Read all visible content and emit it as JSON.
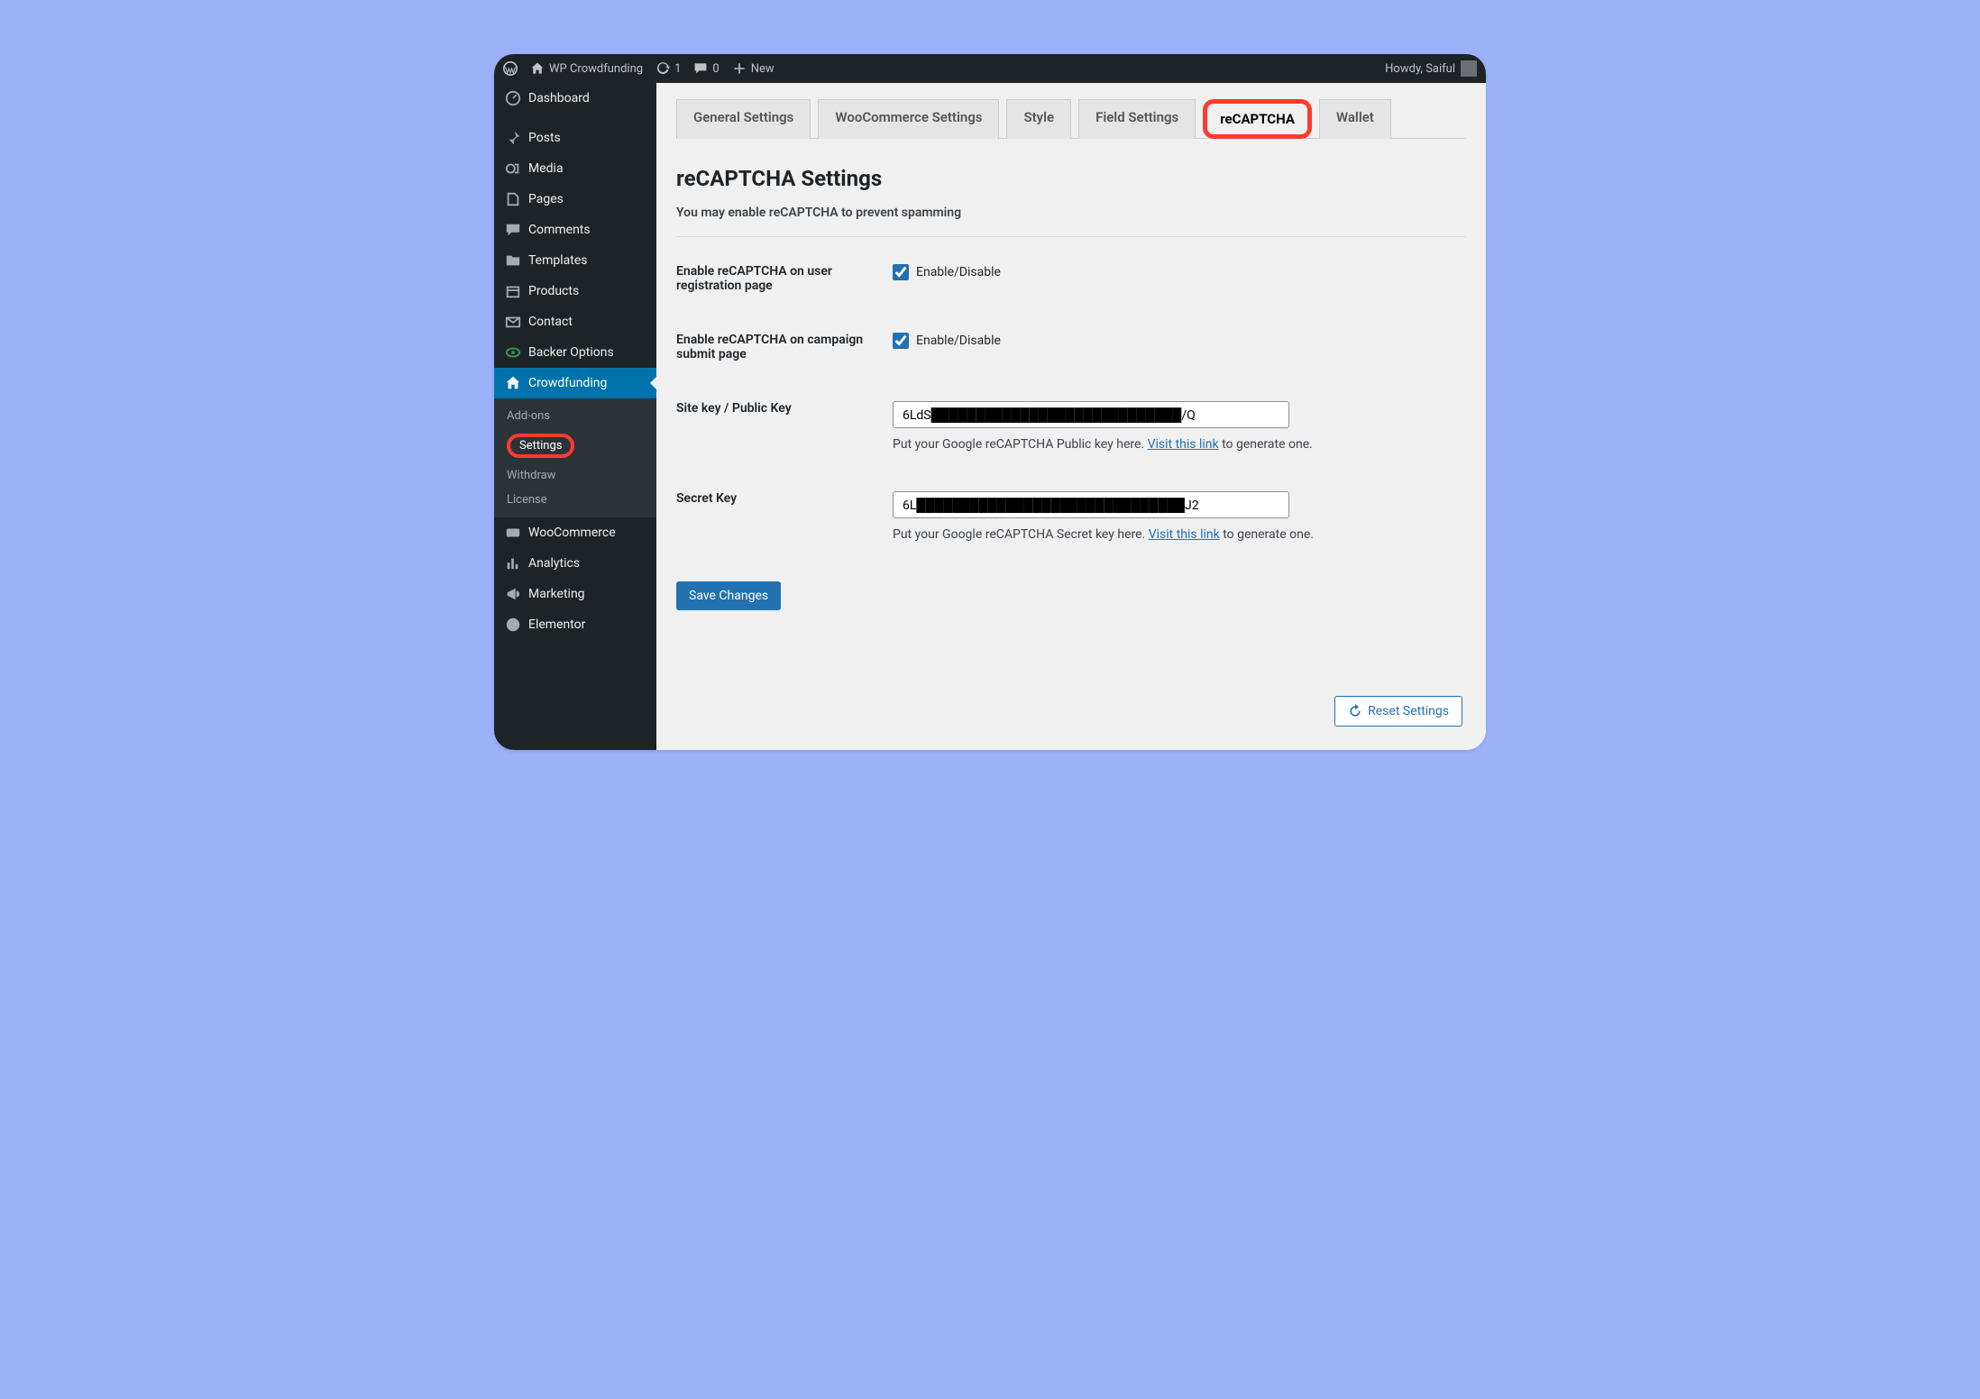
{
  "adminbar": {
    "site": "WP Crowdfunding",
    "updates": "1",
    "comments": "0",
    "new": "New",
    "greeting": "Howdy, Saiful"
  },
  "sidebar": {
    "dashboard": "Dashboard",
    "posts": "Posts",
    "media": "Media",
    "pages": "Pages",
    "comments": "Comments",
    "templates": "Templates",
    "products": "Products",
    "contact": "Contact",
    "backer": "Backer Options",
    "crowdfunding": "Crowdfunding",
    "submenu": {
      "addons": "Add-ons",
      "settings": "Settings",
      "withdraw": "Withdraw",
      "license": "License"
    },
    "woocommerce": "WooCommerce",
    "analytics": "Analytics",
    "marketing": "Marketing",
    "elementor": "Elementor"
  },
  "tabs": {
    "general": "General Settings",
    "woo": "WooCommerce Settings",
    "style": "Style",
    "field": "Field Settings",
    "recaptcha": "reCAPTCHA",
    "wallet": "Wallet"
  },
  "page": {
    "title": "reCAPTCHA Settings",
    "desc": "You may enable reCAPTCHA to prevent spamming"
  },
  "fields": {
    "reg": {
      "label": "Enable reCAPTCHA on user registration page",
      "option": "Enable/Disable"
    },
    "camp": {
      "label": "Enable reCAPTCHA on campaign submit page",
      "option": "Enable/Disable"
    },
    "sitekey": {
      "label": "Site key / Public Key",
      "value": "6LdS████████████████████████████/Q",
      "help1": "Put your Google reCAPTCHA Public key here. ",
      "link": "Visit this link",
      "help2": " to generate one."
    },
    "secret": {
      "label": "Secret Key",
      "value": "6L██████████████████████████████J2",
      "help1": "Put your Google reCAPTCHA Secret key here. ",
      "link": "Visit this link",
      "help2": " to generate one."
    }
  },
  "buttons": {
    "save": "Save Changes",
    "reset": "Reset Settings"
  }
}
